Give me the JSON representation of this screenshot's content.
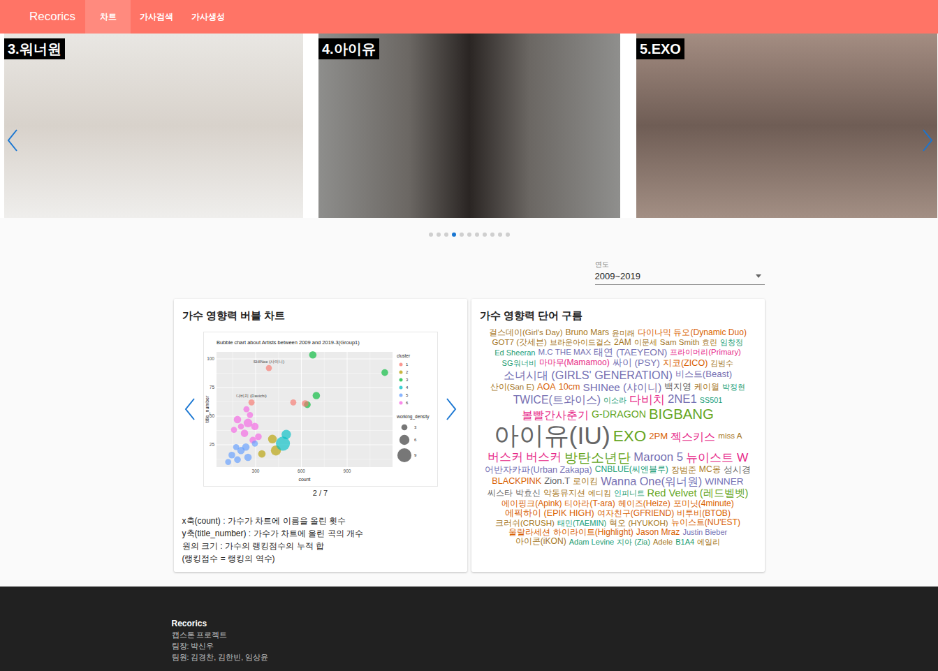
{
  "nav": {
    "brand": "Recorics",
    "tabs": [
      {
        "label": "차트",
        "selected": true
      },
      {
        "label": "가사검색",
        "selected": false
      },
      {
        "label": "가사생성",
        "selected": false
      }
    ]
  },
  "carousel": {
    "slides": [
      {
        "label": "3.워너원"
      },
      {
        "label": "4.아이유"
      },
      {
        "label": "5.EXO"
      }
    ],
    "dots": [
      {
        "selected": false
      },
      {
        "selected": false
      },
      {
        "selected": false
      },
      {
        "selected": true
      },
      {
        "selected": false
      },
      {
        "selected": false
      },
      {
        "selected": false
      },
      {
        "selected": false
      },
      {
        "selected": false
      },
      {
        "selected": false
      },
      {
        "selected": false
      }
    ]
  },
  "filter": {
    "label": "연도",
    "value": "2009~2019"
  },
  "bubble_card": {
    "title": "가수 영향력 버블 차트",
    "page": "2 / 7",
    "description": [
      "x축(count) : 가수가 차트에 이름을 올린 횟수",
      "y축(title_number) : 가수가 차트에 올린 곡의 개수",
      "원의 크기 : 가수의 랭킹점수의 누적 합",
      "(랭킹점수 = 랭킹의 역수)"
    ],
    "chart": {
      "title": "Bubble chart about Artists between 2009 and 2019-3(Group1)",
      "x_label": "count",
      "y_label": "title_number",
      "x_ticks": [
        "300",
        "600",
        "900"
      ],
      "y_ticks": [
        "25",
        "50",
        "75",
        "100"
      ],
      "cluster_legend": {
        "title": "cluster",
        "items": [
          {
            "label": "1",
            "color": "#F8766D"
          },
          {
            "label": "2",
            "color": "#B79F00"
          },
          {
            "label": "3",
            "color": "#00BA38"
          },
          {
            "label": "4",
            "color": "#00BFC4"
          },
          {
            "label": "5",
            "color": "#619CFF"
          },
          {
            "label": "6",
            "color": "#F564E3"
          }
        ]
      },
      "size_legend": {
        "title": "working_density",
        "items": [
          "3",
          "6",
          "9"
        ]
      },
      "points": [
        {
          "count": 675,
          "title_number": 103.5,
          "density": 4,
          "cluster": "3"
        },
        {
          "count": 1147,
          "title_number": 88,
          "density": 3.5,
          "cluster": "3"
        },
        {
          "count": 698,
          "title_number": 68,
          "density": 4,
          "cluster": "3"
        },
        {
          "count": 639,
          "title_number": 60,
          "density": 3.5,
          "cluster": "3"
        },
        {
          "count": 387,
          "title_number": 92,
          "density": 3,
          "cluster": "1",
          "label": "SHINee (샤이니)"
        },
        {
          "count": 273,
          "title_number": 62,
          "density": 3,
          "cluster": "1",
          "label": "다비치 (Davichi)"
        },
        {
          "count": 547,
          "title_number": 62,
          "density": 3,
          "cluster": "1"
        },
        {
          "count": 625,
          "title_number": 61,
          "density": 3.5,
          "cluster": "1"
        },
        {
          "count": 181,
          "title_number": 47,
          "density": 4,
          "cluster": "6"
        },
        {
          "count": 250,
          "title_number": 44,
          "density": 5,
          "cluster": "6"
        },
        {
          "count": 227,
          "title_number": 35,
          "density": 4,
          "cluster": "6"
        },
        {
          "count": 295,
          "title_number": 41,
          "density": 4,
          "cluster": "6"
        },
        {
          "count": 204,
          "title_number": 41,
          "density": 3,
          "cluster": "6"
        },
        {
          "count": 318,
          "title_number": 32,
          "density": 3.5,
          "cluster": "6"
        },
        {
          "count": 263,
          "title_number": 51,
          "density": 3,
          "cluster": "6"
        },
        {
          "count": 158,
          "title_number": 38,
          "density": 3,
          "cluster": "6"
        },
        {
          "count": 282,
          "title_number": 29,
          "density": 3.5,
          "cluster": "6"
        },
        {
          "count": 240,
          "title_number": 56,
          "density": 3,
          "cluster": "6"
        },
        {
          "count": 144,
          "title_number": 16,
          "density": 3.5,
          "cluster": "5"
        },
        {
          "count": 204,
          "title_number": 20,
          "density": 4,
          "cluster": "5"
        },
        {
          "count": 236,
          "title_number": 23,
          "density": 4,
          "cluster": "5"
        },
        {
          "count": 181,
          "title_number": 12,
          "density": 3.5,
          "cluster": "5"
        },
        {
          "count": 172,
          "title_number": 23,
          "density": 3,
          "cluster": "5"
        },
        {
          "count": 250,
          "title_number": 14,
          "density": 4,
          "cluster": "5"
        },
        {
          "count": 295,
          "title_number": 26,
          "density": 3,
          "cluster": "5"
        },
        {
          "count": 120,
          "title_number": 10,
          "density": 3,
          "cluster": "5"
        },
        {
          "count": 410,
          "title_number": 30,
          "density": 5,
          "cluster": "2"
        },
        {
          "count": 433,
          "title_number": 20,
          "density": 6,
          "cluster": "2"
        },
        {
          "count": 341,
          "title_number": 17,
          "density": 4,
          "cluster": "2"
        },
        {
          "count": 479,
          "title_number": 26,
          "density": 9,
          "cluster": "4"
        },
        {
          "count": 501,
          "title_number": 34,
          "density": 5.5,
          "cluster": "4"
        }
      ]
    }
  },
  "cloud_card": {
    "title": "가수 영향력 단어 구름",
    "words": [
      {
        "text": "걸스데이(Girl's Day)",
        "weight": 0.08,
        "color": "#a6761d"
      },
      {
        "text": "Bruno Mars",
        "weight": 0.1,
        "color": "#a6761d"
      },
      {
        "text": "윤미래",
        "weight": 0.05,
        "color": "#a6761d"
      },
      {
        "text": "다이나믹 듀오(Dynamic Duo)",
        "weight": 0.1,
        "color": "#d95f02"
      },
      {
        "text": "GOT7 (갓세븐)",
        "weight": 0.08,
        "color": "#a6761d"
      },
      {
        "text": "브라운아이드걸스",
        "weight": 0.06,
        "color": "#a6761d"
      },
      {
        "text": "2AM",
        "weight": 0.1,
        "color": "#a6761d"
      },
      {
        "text": "이문세",
        "weight": 0.05,
        "color": "#a6761d"
      },
      {
        "text": "Sam Smith",
        "weight": 0.08,
        "color": "#a6761d"
      },
      {
        "text": "효린",
        "weight": 0.05,
        "color": "#a6761d"
      },
      {
        "text": "임창정",
        "weight": 0.05,
        "color": "#1b9e77"
      },
      {
        "text": "Ed Sheeran",
        "weight": 0.06,
        "color": "#1b9e77"
      },
      {
        "text": "M.C THE MAX",
        "weight": 0.08,
        "color": "#7570b3"
      },
      {
        "text": "태연 (TAEYEON)",
        "weight": 0.16,
        "color": "#7570b3"
      },
      {
        "text": "프라이머리(Primary)",
        "weight": 0.07,
        "color": "#e7298a"
      },
      {
        "text": "SG워너비",
        "weight": 0.06,
        "color": "#1b9e77"
      },
      {
        "text": "마마무(Mamamoo)",
        "weight": 0.1,
        "color": "#e7298a"
      },
      {
        "text": "싸이 (PSY)",
        "weight": 0.16,
        "color": "#7570b3"
      },
      {
        "text": "지코(ZICO)",
        "weight": 0.12,
        "color": "#d95f02"
      },
      {
        "text": "김범수",
        "weight": 0.06,
        "color": "#a6761d"
      },
      {
        "text": "소녀시대 (GIRLS' GENERATION)",
        "weight": 0.26,
        "color": "#7570b3"
      },
      {
        "text": "비스트(Beast)",
        "weight": 0.14,
        "color": "#7570b3"
      },
      {
        "text": "산이(San E)",
        "weight": 0.08,
        "color": "#a6761d"
      },
      {
        "text": "AOA",
        "weight": 0.12,
        "color": "#d95f02"
      },
      {
        "text": "10cm",
        "weight": 0.12,
        "color": "#d95f02"
      },
      {
        "text": "SHINee (샤이니)",
        "weight": 0.22,
        "color": "#7570b3"
      },
      {
        "text": "백지영",
        "weight": 0.14,
        "color": "#666666"
      },
      {
        "text": "케이윌",
        "weight": 0.08,
        "color": "#a6761d"
      },
      {
        "text": "박정현",
        "weight": 0.06,
        "color": "#1b9e77"
      },
      {
        "text": "TWICE(트와이스)",
        "weight": 0.24,
        "color": "#7570b3"
      },
      {
        "text": "이소라",
        "weight": 0.05,
        "color": "#1b9e77"
      },
      {
        "text": "다비치",
        "weight": 0.3,
        "color": "#e7298a"
      },
      {
        "text": "2NE1",
        "weight": 0.28,
        "color": "#7570b3"
      },
      {
        "text": "SS501",
        "weight": 0.05,
        "color": "#1b9e77"
      },
      {
        "text": "볼빨간사춘기",
        "weight": 0.26,
        "color": "#e7298a"
      },
      {
        "text": "G-DRAGON",
        "weight": 0.18,
        "color": "#66a61e"
      },
      {
        "text": "BIGBANG",
        "weight": 0.42,
        "color": "#66a61e"
      },
      {
        "text": "아이유(IU)",
        "weight": 1,
        "color": "#666666"
      },
      {
        "text": "EXO",
        "weight": 0.5,
        "color": "#66a61e"
      },
      {
        "text": "2PM",
        "weight": 0.14,
        "color": "#d95f02"
      },
      {
        "text": "젝스키스",
        "weight": 0.26,
        "color": "#e7298a"
      },
      {
        "text": "miss A",
        "weight": 0.08,
        "color": "#a6761d"
      },
      {
        "text": "버스커 버스커",
        "weight": 0.28,
        "color": "#e7298a"
      },
      {
        "text": "방탄소년단",
        "weight": 0.36,
        "color": "#66a61e"
      },
      {
        "text": "Maroon 5",
        "weight": 0.28,
        "color": "#7570b3"
      },
      {
        "text": "뉴이스트 W",
        "weight": 0.3,
        "color": "#e7298a"
      },
      {
        "text": "어반자카파(Urban Zakapa)",
        "weight": 0.12,
        "color": "#7570b3"
      },
      {
        "text": "CNBLUE(씨엔블루)",
        "weight": 0.1,
        "color": "#1b9e77"
      },
      {
        "text": "장범준",
        "weight": 0.08,
        "color": "#a6761d"
      },
      {
        "text": "MC몽",
        "weight": 0.1,
        "color": "#a6761d"
      },
      {
        "text": "성시경",
        "weight": 0.12,
        "color": "#666666"
      },
      {
        "text": "BLACKPINK",
        "weight": 0.12,
        "color": "#d95f02"
      },
      {
        "text": "Zion.T",
        "weight": 0.14,
        "color": "#666666"
      },
      {
        "text": "로이킴",
        "weight": 0.08,
        "color": "#a6761d"
      },
      {
        "text": "Wanna One(워너원)",
        "weight": 0.26,
        "color": "#7570b3"
      },
      {
        "text": "WINNER",
        "weight": 0.16,
        "color": "#7570b3"
      },
      {
        "text": "씨스타",
        "weight": 0.1,
        "color": "#666666"
      },
      {
        "text": "박효신",
        "weight": 0.1,
        "color": "#666666"
      },
      {
        "text": "악동뮤지션",
        "weight": 0.08,
        "color": "#a6761d"
      },
      {
        "text": "에디킴",
        "weight": 0.06,
        "color": "#a6761d"
      },
      {
        "text": "인피니트",
        "weight": 0.07,
        "color": "#1b9e77"
      },
      {
        "text": "Red Velvet (레드벨벳)",
        "weight": 0.2,
        "color": "#66a61e"
      },
      {
        "text": "에이핑크(Apink)",
        "weight": 0.1,
        "color": "#d95f02"
      },
      {
        "text": "티아라(T-ara)",
        "weight": 0.1,
        "color": "#d95f02"
      },
      {
        "text": "헤이즈(Heize)",
        "weight": 0.1,
        "color": "#d95f02"
      },
      {
        "text": "포미닛(4minute)",
        "weight": 0.1,
        "color": "#d95f02"
      },
      {
        "text": "에픽하이 (EPIK HIGH)",
        "weight": 0.12,
        "color": "#d95f02"
      },
      {
        "text": "여자친구(GFRIEND)",
        "weight": 0.1,
        "color": "#d95f02"
      },
      {
        "text": "비투비(BTOB)",
        "weight": 0.1,
        "color": "#d95f02"
      },
      {
        "text": "크러쉬(CRUSH)",
        "weight": 0.08,
        "color": "#a6761d"
      },
      {
        "text": "태민(TAEMIN)",
        "weight": 0.06,
        "color": "#1b9e77"
      },
      {
        "text": "혁오 (HYUKOH)",
        "weight": 0.08,
        "color": "#a6761d"
      },
      {
        "text": "뉴이스트(NU'EST)",
        "weight": 0.1,
        "color": "#d95f02"
      },
      {
        "text": "울랄라세션",
        "weight": 0.1,
        "color": "#d95f02"
      },
      {
        "text": "하이라이트(Highlight)",
        "weight": 0.1,
        "color": "#d95f02"
      },
      {
        "text": "Jason Mraz",
        "weight": 0.1,
        "color": "#d95f02"
      },
      {
        "text": "Justin Bieber",
        "weight": 0.06,
        "color": "#7570b3"
      },
      {
        "text": "아이콘(iKON)",
        "weight": 0.1,
        "color": "#a6761d"
      },
      {
        "text": "Adam Levine",
        "weight": 0.06,
        "color": "#1b9e77"
      },
      {
        "text": "지아 (Zia)",
        "weight": 0.06,
        "color": "#1b9e77"
      },
      {
        "text": "Adele",
        "weight": 0.06,
        "color": "#a6761d"
      },
      {
        "text": "B1A4",
        "weight": 0.06,
        "color": "#1b9e77"
      },
      {
        "text": "에일리",
        "weight": 0.06,
        "color": "#a6761d"
      }
    ]
  },
  "footer": {
    "brand": "Recorics",
    "lines": [
      "캡스톤 프로젝트",
      "팀장: 박신우",
      "팀원: 김경찬, 김한빈, 임상윤"
    ]
  }
}
